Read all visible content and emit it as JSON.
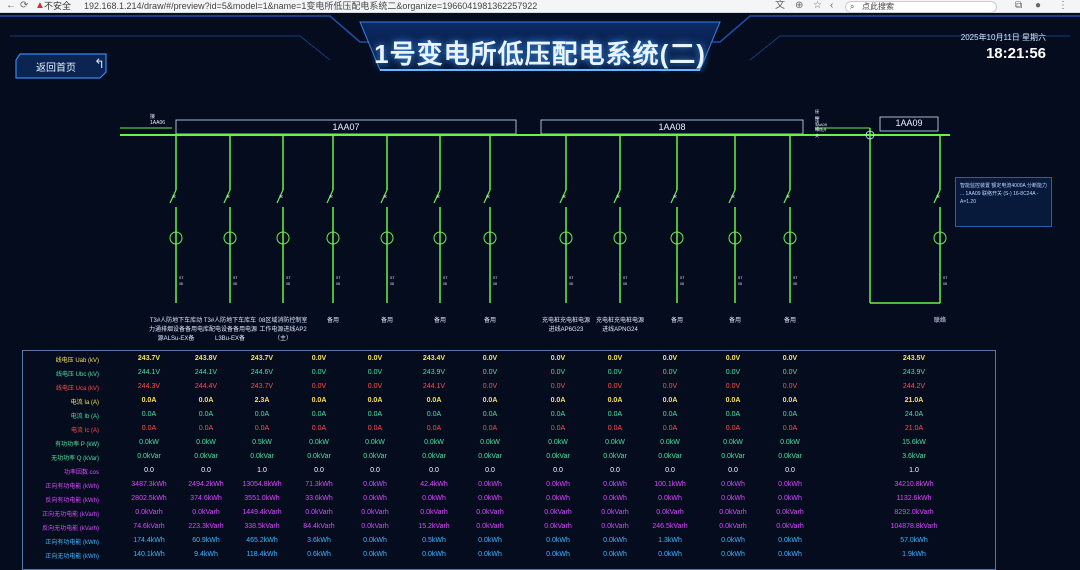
{
  "browser": {
    "security": "不安全",
    "url": "192.168.1.214/draw/#/preview?id=5&model=1&name=1变电所低压配电系统二&organize=1966041981362257922",
    "search_placeholder": "点此搜索"
  },
  "header": {
    "title": "1号变电所低压配电系统(二)",
    "date": "2025年10月11日 星期六",
    "time": "18:21:56",
    "back_label": "返回首页"
  },
  "buses": [
    {
      "label": "1AA07"
    },
    {
      "label": "1AA08"
    },
    {
      "label": "1AA09"
    }
  ],
  "bus_side_labels": {
    "left": "接1AA06",
    "right_line1": "接5#进线",
    "right_line2": "接1AA09母线开关"
  },
  "feeders": [
    {
      "label": "T3#人防地下车库动\n力通排烟设备备用电\n源ALSu-EX备"
    },
    {
      "label": "T3#人防地下车库车\n库配电设备备用电源\nL3Bu-EX备"
    },
    {
      "label": "08区域消防控制室\n工作电源进线AP2\n（主）"
    },
    {
      "label": "备用"
    },
    {
      "label": "备用"
    },
    {
      "label": "备用"
    },
    {
      "label": "备用"
    },
    {
      "label": "充电桩充电桩电源\n进线AP6G23"
    },
    {
      "label": "充电桩充电桩电源\n进线APNG24"
    },
    {
      "label": "备用"
    },
    {
      "label": "备用"
    },
    {
      "label": "备用"
    },
    {
      "label": "联络"
    }
  ],
  "infobox": {
    "text": "智能监控装置 额定电流4000A 分断能力 ... 1AA09 联络开关 (S-) 16-8C24A -A=1.20"
  },
  "table": {
    "row_labels": [
      "线电压 Uab (kV)",
      "线电压 Ubc (kV)",
      "线电压 Uca (kV)",
      "电流 Ia (A)",
      "电流 Ib (A)",
      "电流 Ic (A)",
      "有功功率 P (kW)",
      "无功功率 Q (kVar)",
      "功率因数 cos",
      "正向有功电能 (kWh)",
      "反向有功电能 (kWh)",
      "正向无功电能 (kVarh)",
      "反向无功电能 (kVarh)",
      "正向有功电能 (kWh)",
      "正向无功电能 (kWh)"
    ],
    "columns": [
      [
        "243.7V",
        "244.1V",
        "244.3V",
        "0.0A",
        "0.0A",
        "0.0A",
        "0.0kW",
        "0.0kVar",
        "0.0",
        "3487.3kWh",
        "2802.5kWh",
        "0.0kVarh",
        "74.6kVarh",
        "174.4kWh",
        "140.1kWh"
      ],
      [
        "243.8V",
        "244.1V",
        "244.4V",
        "0.0A",
        "0.0A",
        "0.0A",
        "0.0kW",
        "0.0kVar",
        "0.0",
        "2494.2kWh",
        "374.6kWh",
        "0.0kVarh",
        "223.3kVarh",
        "60.9kWh",
        "9.4kWh"
      ],
      [
        "243.7V",
        "244.6V",
        "243.7V",
        "2.3A",
        "0.0A",
        "0.0A",
        "0.5kW",
        "0.0kVar",
        "1.0",
        "13054.8kWh",
        "3551.0kWh",
        "1449.4kVarh",
        "338.5kVarh",
        "465.2kWh",
        "118.4kWh"
      ],
      [
        "0.0V",
        "0.0V",
        "0.0V",
        "0.0A",
        "0.0A",
        "0.0A",
        "0.0kW",
        "0.0kVar",
        "0.0",
        "71.3kWh",
        "33.6kWh",
        "0.0kVarh",
        "84.4kVarh",
        "3.6kWh",
        "0.6kWh"
      ],
      [
        "0.0V",
        "0.0V",
        "0.0V",
        "0.0A",
        "0.0A",
        "0.0A",
        "0.0kW",
        "0.0kVar",
        "0.0",
        "0.0kWh",
        "0.0kWh",
        "0.0kVarh",
        "0.0kVarh",
        "0.0kWh",
        "0.0kWh"
      ],
      [
        "243.4V",
        "243.9V",
        "244.1V",
        "0.0A",
        "0.0A",
        "0.0A",
        "0.0kW",
        "0.0kVar",
        "0.0",
        "42.4kWh",
        "0.0kWh",
        "0.0kVarh",
        "15.2kVarh",
        "0.5kWh",
        "0.0kWh"
      ],
      [
        "0.0V",
        "0.0V",
        "0.0V",
        "0.0A",
        "0.0A",
        "0.0A",
        "0.0kW",
        "0.0kVar",
        "0.0",
        "0.0kWh",
        "0.0kWh",
        "0.0kVarh",
        "0.0kVarh",
        "0.0kWh",
        "0.0kWh"
      ],
      [
        "0.0V",
        "0.0V",
        "0.0V",
        "0.0A",
        "0.0A",
        "0.0A",
        "0.0kW",
        "0.0kVar",
        "0.0",
        "0.0kWh",
        "0.0kWh",
        "0.0kVarh",
        "0.0kVarh",
        "0.0kWh",
        "0.0kWh"
      ],
      [
        "0.0V",
        "0.0V",
        "0.0V",
        "0.0A",
        "0.0A",
        "0.0A",
        "0.0kW",
        "0.0kVar",
        "0.0",
        "0.0kWh",
        "0.0kWh",
        "0.0kVarh",
        "0.0kVarh",
        "0.0kWh",
        "0.0kWh"
      ],
      [
        "0.0V",
        "0.0V",
        "0.0V",
        "0.0A",
        "0.0A",
        "0.0A",
        "0.0kW",
        "0.0kVar",
        "0.0",
        "100.1kWh",
        "0.0kWh",
        "0.0kVarh",
        "246.5kVarh",
        "1.3kWh",
        "0.0kWh"
      ],
      [
        "0.0V",
        "0.0V",
        "0.0V",
        "0.0A",
        "0.0A",
        "0.0A",
        "0.0kW",
        "0.0kVar",
        "0.0",
        "0.0kWh",
        "0.0kWh",
        "0.0kVarh",
        "0.0kVarh",
        "0.0kWh",
        "0.0kWh"
      ],
      [
        "0.0V",
        "0.0V",
        "0.0V",
        "0.0A",
        "0.0A",
        "0.0A",
        "0.0kW",
        "0.0kVar",
        "0.0",
        "0.0kWh",
        "0.0kWh",
        "0.0kVarh",
        "0.0kVarh",
        "0.0kWh",
        "0.0kWh"
      ],
      [
        "243.5V",
        "243.9V",
        "244.2V",
        "21.0A",
        "24.0A",
        "21.0A",
        "15.6kW",
        "3.6kVar",
        "1.0",
        "34210.8kWh",
        "1132.6kWh",
        "8292.0kVarh",
        "104878.8kVarh",
        "57.0kWh",
        "1.9kWh"
      ]
    ]
  },
  "colors": {
    "bg": "#050c1e",
    "bus": "#6cf04b",
    "label_yellow": "#f5e356",
    "label_green": "#4ce0a2",
    "label_red": "#ff4e4e",
    "label_purple": "#d84bff",
    "label_blue": "#41b5ff"
  }
}
